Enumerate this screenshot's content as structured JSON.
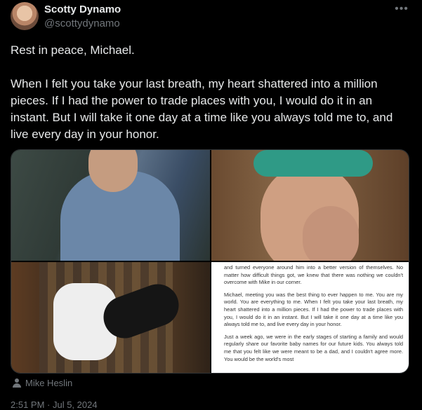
{
  "author": {
    "name": "Scotty Dynamo",
    "handle": "@scottydynamo"
  },
  "more_icon": "more-horizontal-icon",
  "post": {
    "paragraphs": [
      "Rest in peace, Michael.",
      "When I felt you take your last breath, my heart shattered into a million pieces. If I had the power to trade places with you, I would do it in an instant. But I will take it one day at a time like you always told me to, and live every day in your honor."
    ]
  },
  "media": {
    "letter_paragraphs": [
      "and turned everyone around him into a better version of themselves. No matter how difficult things got, we knew that there was nothing we couldn't overcome with Mike in our corner.",
      "Michael, meeting you was the best thing to ever happen to me. You are my world. You are everything to me. When I felt you take your last breath, my heart shattered into a million pieces. If I had the power to trade places with you, I would do it in an instant. But I will take it one day at a time like you always told me to, and live every day in your honor.",
      "Just a week ago, we were in the early stages of starting a family and would regularly share our favorite baby names for our future kids. You always told me that you felt like we were meant to be a dad, and I couldn't agree more. You would be the world's most"
    ],
    "credit": "Mike Heslin"
  },
  "timestamp": "2:51 PM · Jul 5, 2024"
}
